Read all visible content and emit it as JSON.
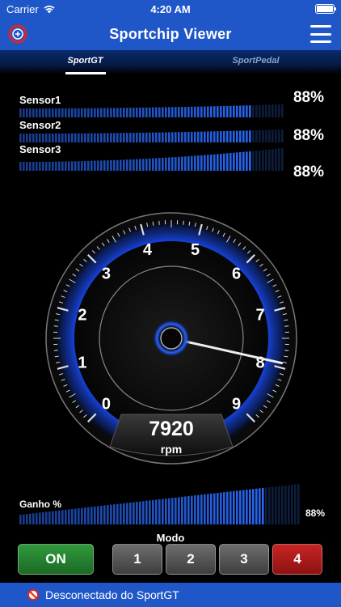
{
  "status_bar": {
    "carrier": "Carrier",
    "time": "4:20 AM"
  },
  "nav": {
    "title": "Sportchip Viewer"
  },
  "tabs": [
    {
      "label": "SportGT",
      "active": true
    },
    {
      "label": "SportPedal",
      "active": false
    }
  ],
  "sensors": [
    {
      "label": "Sensor1",
      "value": "88%",
      "level": 0.88
    },
    {
      "label": "Sensor2",
      "value": "88%",
      "level": 0.88
    },
    {
      "label": "Sensor3",
      "value": "88%",
      "level": 0.88
    }
  ],
  "gauge": {
    "ticks": [
      "0",
      "1",
      "2",
      "3",
      "4",
      "5",
      "6",
      "7",
      "8",
      "9"
    ],
    "rpm_value": "7920",
    "rpm_unit": "rpm",
    "needle_value": 7.92,
    "max": 9
  },
  "gain": {
    "label": "Ganho  %",
    "value": "88%",
    "level": 0.88
  },
  "mode": {
    "title": "Modo",
    "on_label": "ON",
    "buttons": [
      {
        "label": "1",
        "active": false
      },
      {
        "label": "2",
        "active": false
      },
      {
        "label": "3",
        "active": false
      },
      {
        "label": "4",
        "active": true
      }
    ]
  },
  "banner": {
    "text": "Desconectado do SportGT"
  },
  "colors": {
    "brand_blue": "#1f57c9",
    "on_green": "#2f9a3b",
    "active_red": "#c82424",
    "bar_blue": "#2a6cff"
  }
}
